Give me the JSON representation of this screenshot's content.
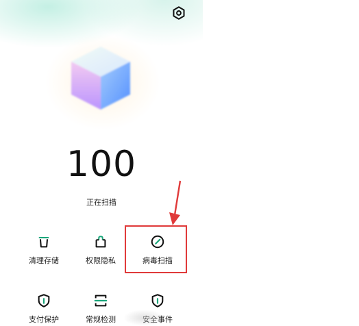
{
  "header": {
    "settings_icon": "gear-icon"
  },
  "hero": {
    "score": "100",
    "status": "正在扫描"
  },
  "features": [
    {
      "label": "清理存储",
      "icon": "trash-icon"
    },
    {
      "label": "权限隐私",
      "icon": "lock-icon"
    },
    {
      "label": "病毒扫描",
      "icon": "scan-icon"
    },
    {
      "label": "支付保护",
      "icon": "shield-icon"
    },
    {
      "label": "常规检测",
      "icon": "scan-frame-icon"
    },
    {
      "label": "安全事件",
      "icon": "shield-icon"
    }
  ],
  "colors": {
    "accent": "#1aa67a",
    "highlight": "#e03a3a"
  }
}
